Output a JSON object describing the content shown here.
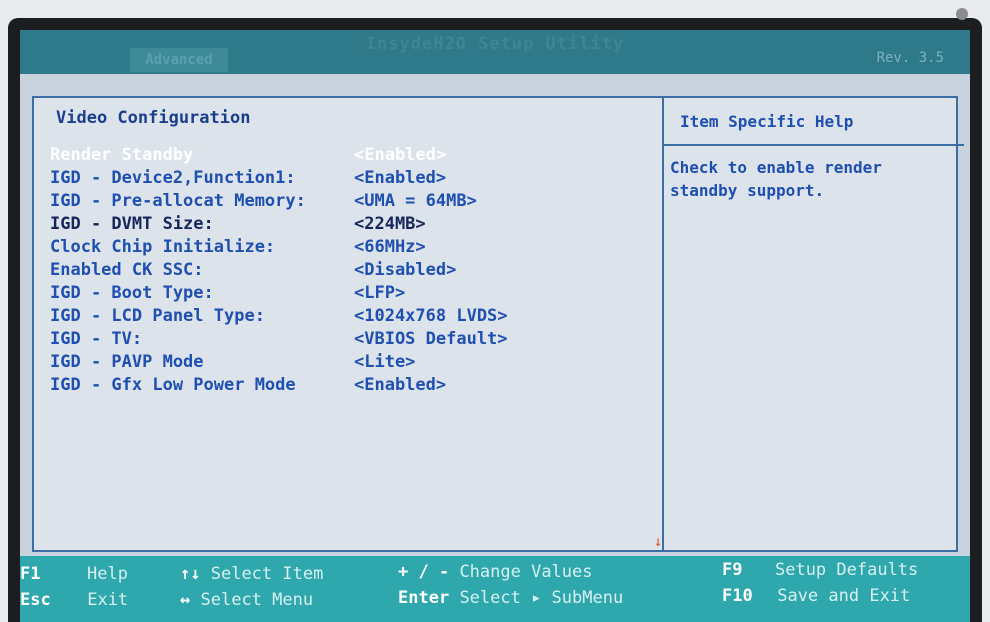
{
  "header": {
    "title": "InsydeH2O Setup Utility",
    "active_tab": "Advanced",
    "right_label": "Rev. 3.5"
  },
  "main": {
    "section_title": "Video Configuration",
    "settings": [
      {
        "label": "Render Standby",
        "value": "<Enabled>"
      },
      {
        "label": "IGD - Device2,Function1:",
        "value": "<Enabled>"
      },
      {
        "label": "IGD - Pre-allocat Memory:",
        "value": "<UMA = 64MB>"
      },
      {
        "label": "IGD - DVMT Size:",
        "value": "<224MB>"
      },
      {
        "label": "Clock Chip Initialize:",
        "value": "<66MHz>"
      },
      {
        "label": "Enabled CK SSC:",
        "value": "<Disabled>"
      },
      {
        "label": "IGD - Boot Type:",
        "value": "<LFP>"
      },
      {
        "label": "IGD - LCD Panel Type:",
        "value": "<1024x768 LVDS>"
      },
      {
        "label": "IGD - TV:",
        "value": "<VBIOS Default>"
      },
      {
        "label": "IGD - PAVP Mode",
        "value": "<Lite>"
      },
      {
        "label": "IGD - Gfx Low Power Mode",
        "value": "<Enabled>"
      }
    ]
  },
  "help": {
    "title": "Item Specific Help",
    "text": "Check to enable render standby support."
  },
  "footer": {
    "f1_key": "F1",
    "f1_desc": "Help",
    "esc_key": "Esc",
    "esc_desc": "Exit",
    "updown_key": "↑↓",
    "updown_desc": "Select Item",
    "leftright_key": "↔",
    "leftright_desc": "Select Menu",
    "plusminus_key": "+ / -",
    "plusminus_desc": "Change Values",
    "enter_key": "Enter",
    "enter_desc": "Select ▸ SubMenu",
    "f9_key": "F9",
    "f9_desc": "Setup Defaults",
    "f10_key": "F10",
    "f10_desc": "Save and Exit"
  },
  "colors": {
    "selected_text": "#ffffff",
    "setting_text": "#1f4fb0",
    "footer_bg": "#2ea7ad",
    "panel_border": "#3b6ea5"
  }
}
